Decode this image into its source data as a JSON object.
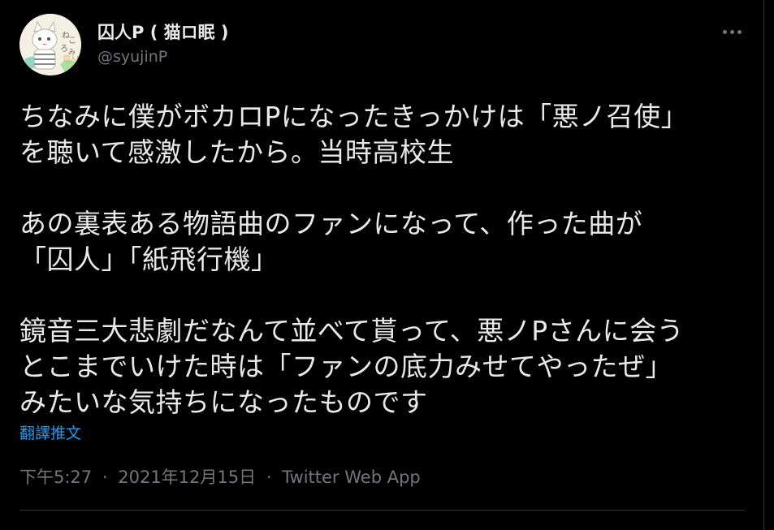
{
  "author": {
    "display_name": "囚人P ( 猫ロ眠 )",
    "handle": "@syujinP",
    "avatar_icon": "cat-avatar-icon"
  },
  "more_icon": "more-horizontal-icon",
  "tweet": {
    "paragraphs": [
      [
        "ちなみに僕がボカロPになったきっかけは「悪ノ召使」",
        "を聴いて感激したから。当時高校生"
      ],
      [
        "あの裏表ある物語曲のファンになって、作った曲が",
        "「囚人」「紙飛行機」"
      ],
      [
        "鏡音三大悲劇だなんて並べて貰って、悪ノPさんに会う",
        "とこまでいけた時は「ファンの底力みせてやったぜ」",
        "みたいな気持ちになったものです"
      ]
    ],
    "translate_label": "翻譯推文",
    "time": "下午5:27",
    "date": "2021年12月15日",
    "separator": "·",
    "source": "Twitter Web App"
  },
  "colors": {
    "background": "#000000",
    "text": "#e7e9ea",
    "secondary": "#71767b",
    "link": "#1d9bf0",
    "border": "#2f3336"
  }
}
